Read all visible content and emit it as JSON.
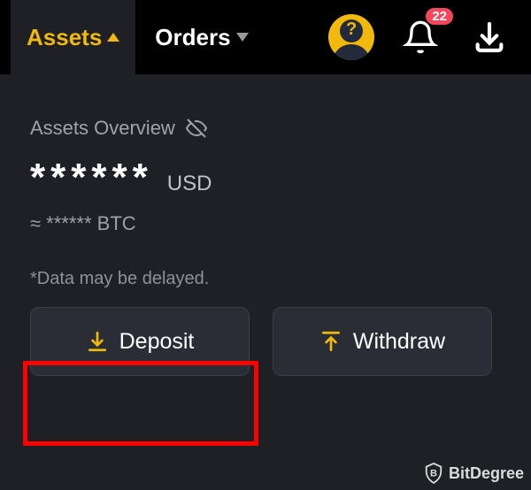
{
  "topbar": {
    "assets_label": "Assets",
    "orders_label": "Orders",
    "notification_count": "22"
  },
  "overview": {
    "title": "Assets Overview",
    "balance_masked": "******",
    "balance_currency": "USD",
    "btc_line": "≈ ****** BTC",
    "delay_note": "*Data may be delayed."
  },
  "buttons": {
    "deposit_label": "Deposit",
    "withdraw_label": "Withdraw"
  },
  "watermark": {
    "text": "BitDegree"
  },
  "colors": {
    "accent": "#f0b90b",
    "badge": "#f6465d",
    "highlight": "#ff0000"
  }
}
